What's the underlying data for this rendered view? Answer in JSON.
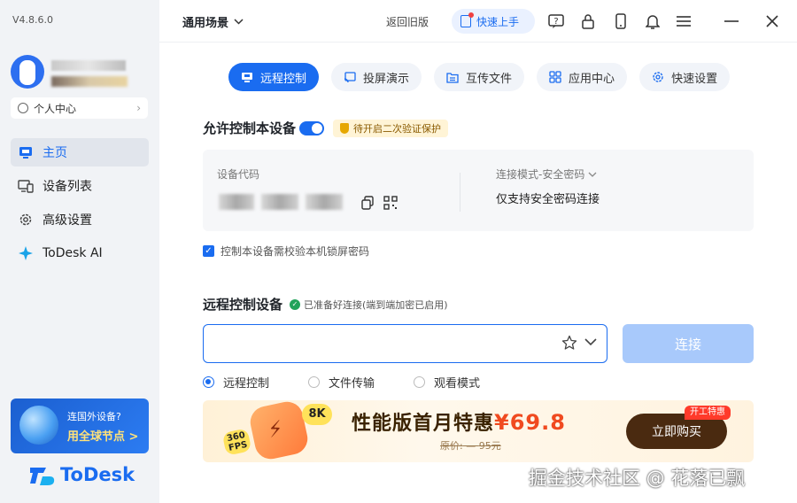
{
  "app": {
    "version": "V4.8.6.0",
    "logo_text": "ToDesk"
  },
  "sidebar": {
    "profile_label": "个人中心",
    "items": [
      {
        "label": "主页",
        "icon": "monitor-icon",
        "active": true
      },
      {
        "label": "设备列表",
        "icon": "devices-icon"
      },
      {
        "label": "高级设置",
        "icon": "gear-icon"
      },
      {
        "label": "ToDesk AI",
        "icon": "sparkle-icon"
      }
    ],
    "promo": {
      "line1": "连国外设备?",
      "line2": "用全球节点 >"
    }
  },
  "topbar": {
    "scene_label": "通用场景",
    "back_old_label": "返回旧版",
    "quick_start_label": "快速上手",
    "icons": [
      "help-icon",
      "lock-icon",
      "phone-icon",
      "bell-icon",
      "menu-icon",
      "minimize-icon",
      "close-icon"
    ]
  },
  "tabs": [
    {
      "label": "远程控制",
      "icon": "monitor-icon",
      "active": true
    },
    {
      "label": "投屏演示",
      "icon": "cast-icon"
    },
    {
      "label": "互传文件",
      "icon": "folder-transfer-icon"
    },
    {
      "label": "应用中心",
      "icon": "apps-icon"
    },
    {
      "label": "快速设置",
      "icon": "gear-icon"
    }
  ],
  "allow_control": {
    "title": "允许控制本设备",
    "toggle_on": true,
    "security_badge": "待开启二次验证保护",
    "device_code_label": "设备代码",
    "connection_mode_label": "连接模式-安全密码",
    "connection_mode_value": "仅支持安全密码连接",
    "lock_screen_check_label": "控制本设备需校验本机锁屏密码",
    "lock_screen_checked": true
  },
  "remote": {
    "title": "远程控制设备",
    "status": "已准备好连接(端到端加密已启用)",
    "input_value": "",
    "input_placeholder": "",
    "connect_label": "连接",
    "modes": [
      {
        "label": "远程控制",
        "selected": true
      },
      {
        "label": "文件传输",
        "selected": false
      },
      {
        "label": "观看模式",
        "selected": false
      }
    ]
  },
  "banner": {
    "badge_8k": "8K",
    "badge_360": "360",
    "badge_fps": "FPS",
    "title": "性能版首月特惠",
    "price": "¥69.8",
    "original_label": "原价:",
    "original_price": "95元",
    "buy_label": "立即购买",
    "tag": "开工特惠"
  },
  "watermark": "掘金技术社区 @ 花落已飘",
  "colors": {
    "accent": "#1a6cf0",
    "sidebar_bg": "#f1f3f6",
    "connect_disabled": "#a8c9fb"
  }
}
